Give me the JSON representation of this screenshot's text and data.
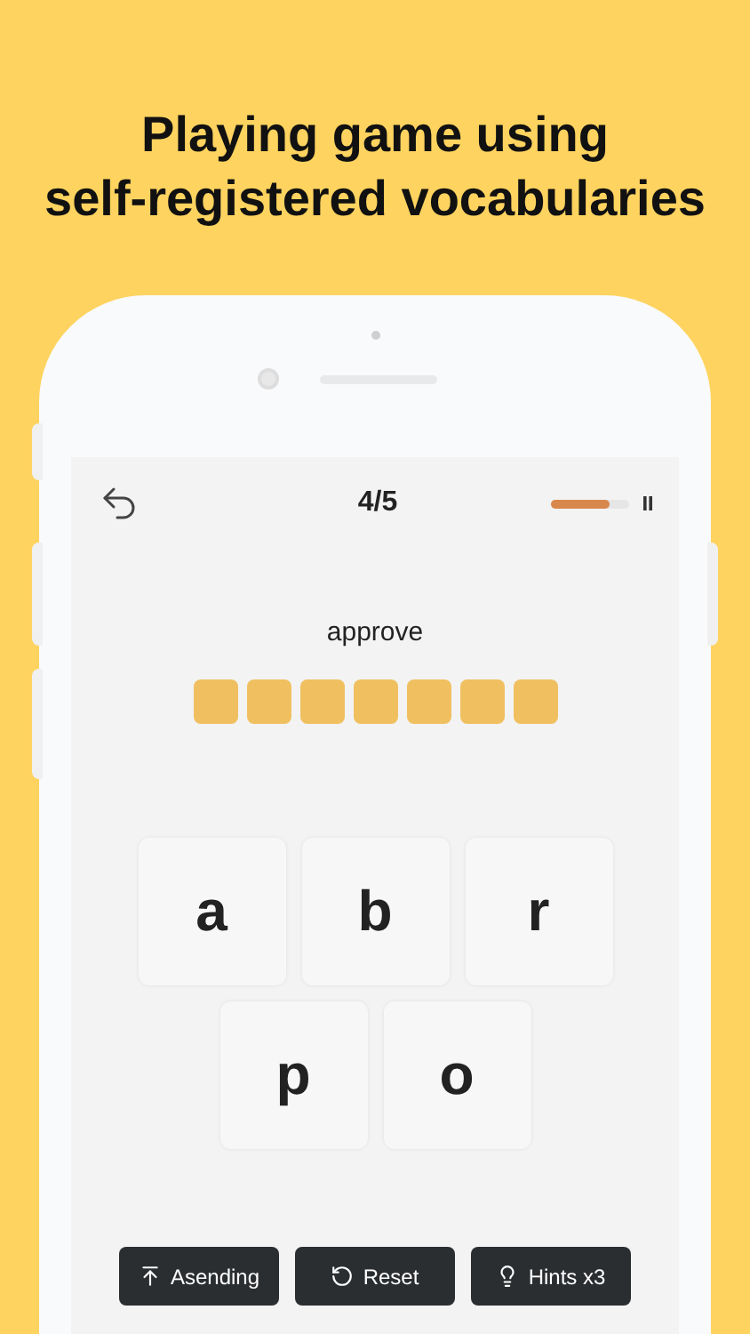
{
  "headline": [
    "Playing game using",
    "self-registered vocabularies"
  ],
  "header": {
    "counter": "4/5",
    "progress": {
      "level": 0.75
    }
  },
  "word": "approve",
  "answer_slots": [
    {
      "filled": false
    },
    {
      "filled": false
    },
    {
      "filled": false
    },
    {
      "filled": false
    },
    {
      "filled": false
    },
    {
      "filled": false
    },
    {
      "filled": false
    }
  ],
  "letter_tiles": [
    {
      "letter": "a"
    },
    {
      "letter": "b"
    },
    {
      "letter": "r"
    },
    {
      "letter": "p"
    },
    {
      "letter": "o"
    }
  ],
  "buttons": [
    {
      "kind": "sort",
      "label": "Asending"
    },
    {
      "kind": "reset",
      "label": "Reset"
    },
    {
      "kind": "hint",
      "label": "Hints x3"
    }
  ]
}
